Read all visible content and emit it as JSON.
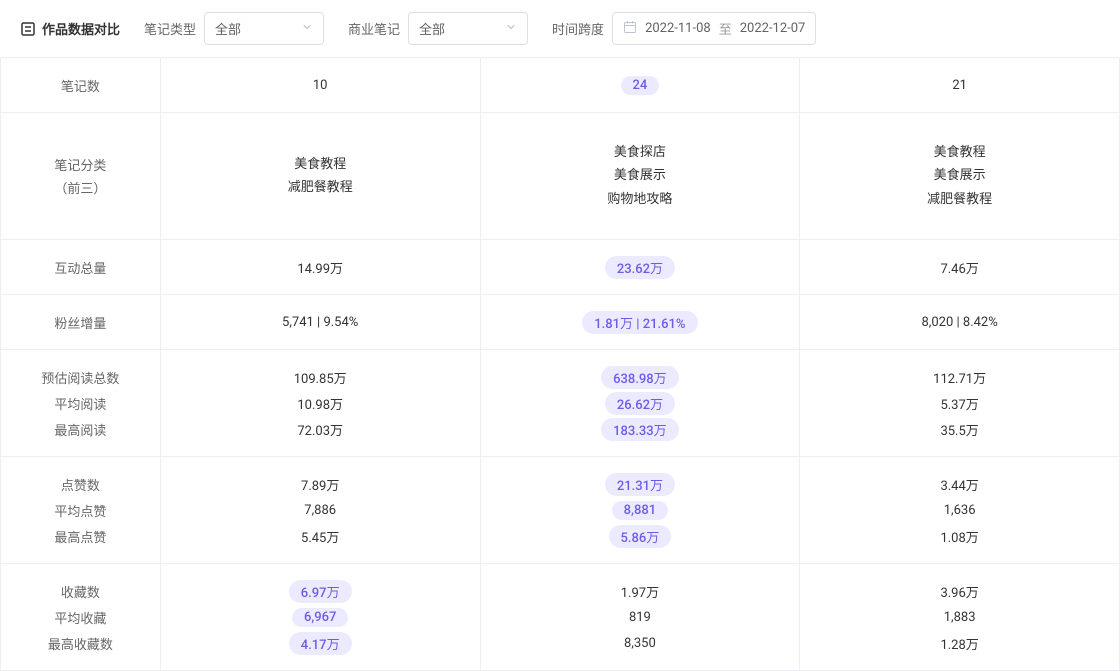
{
  "header": {
    "title": "作品数据对比",
    "filters": {
      "noteType": {
        "label": "笔记类型",
        "value": "全部"
      },
      "bizType": {
        "label": "商业笔记",
        "value": "全部"
      },
      "dateRange": {
        "label": "时间跨度",
        "start": "2022-11-08",
        "sep": "至",
        "end": "2022-12-07"
      }
    }
  },
  "rows": {
    "noteCount": {
      "label": "笔记数",
      "cols": [
        {
          "v": "10",
          "hl": false
        },
        {
          "v": "24",
          "hl": true
        },
        {
          "v": "21",
          "hl": false
        }
      ]
    },
    "categories": {
      "label1": "笔记分类",
      "label2": "（前三）",
      "cols": [
        [
          "美食教程",
          "减肥餐教程"
        ],
        [
          "美食探店",
          "美食展示",
          "购物地攻略"
        ],
        [
          "美食教程",
          "美食展示",
          "减肥餐教程"
        ]
      ]
    },
    "interactTotal": {
      "label": "互动总量",
      "cols": [
        {
          "v": "14.99万",
          "hl": false
        },
        {
          "v": "23.62万",
          "hl": true
        },
        {
          "v": "7.46万",
          "hl": false
        }
      ]
    },
    "fanGrowth": {
      "label": "粉丝增量",
      "cols": [
        {
          "v": "5,741 | 9.54%",
          "hl": false
        },
        {
          "v": "1.81万 | 21.61%",
          "hl": true
        },
        {
          "v": "8,020 | 8.42%",
          "hl": false
        }
      ]
    },
    "reads": {
      "labels": [
        "预估阅读总数",
        "平均阅读",
        "最高阅读"
      ],
      "cols": [
        [
          {
            "v": "109.85万",
            "hl": false
          },
          {
            "v": "10.98万",
            "hl": false
          },
          {
            "v": "72.03万",
            "hl": false
          }
        ],
        [
          {
            "v": "638.98万",
            "hl": true
          },
          {
            "v": "26.62万",
            "hl": true
          },
          {
            "v": "183.33万",
            "hl": true
          }
        ],
        [
          {
            "v": "112.71万",
            "hl": false
          },
          {
            "v": "5.37万",
            "hl": false
          },
          {
            "v": "35.5万",
            "hl": false
          }
        ]
      ]
    },
    "likes": {
      "labels": [
        "点赞数",
        "平均点赞",
        "最高点赞"
      ],
      "cols": [
        [
          {
            "v": "7.89万",
            "hl": false
          },
          {
            "v": "7,886",
            "hl": false
          },
          {
            "v": "5.45万",
            "hl": false
          }
        ],
        [
          {
            "v": "21.31万",
            "hl": true
          },
          {
            "v": "8,881",
            "hl": true
          },
          {
            "v": "5.86万",
            "hl": true
          }
        ],
        [
          {
            "v": "3.44万",
            "hl": false
          },
          {
            "v": "1,636",
            "hl": false
          },
          {
            "v": "1.08万",
            "hl": false
          }
        ]
      ]
    },
    "faves": {
      "labels": [
        "收藏数",
        "平均收藏",
        "最高收藏数"
      ],
      "cols": [
        [
          {
            "v": "6.97万",
            "hl": true
          },
          {
            "v": "6,967",
            "hl": true
          },
          {
            "v": "4.17万",
            "hl": true
          }
        ],
        [
          {
            "v": "1.97万",
            "hl": false
          },
          {
            "v": "819",
            "hl": false
          },
          {
            "v": "8,350",
            "hl": false
          }
        ],
        [
          {
            "v": "3.96万",
            "hl": false
          },
          {
            "v": "1,883",
            "hl": false
          },
          {
            "v": "1.28万",
            "hl": false
          }
        ]
      ]
    }
  }
}
